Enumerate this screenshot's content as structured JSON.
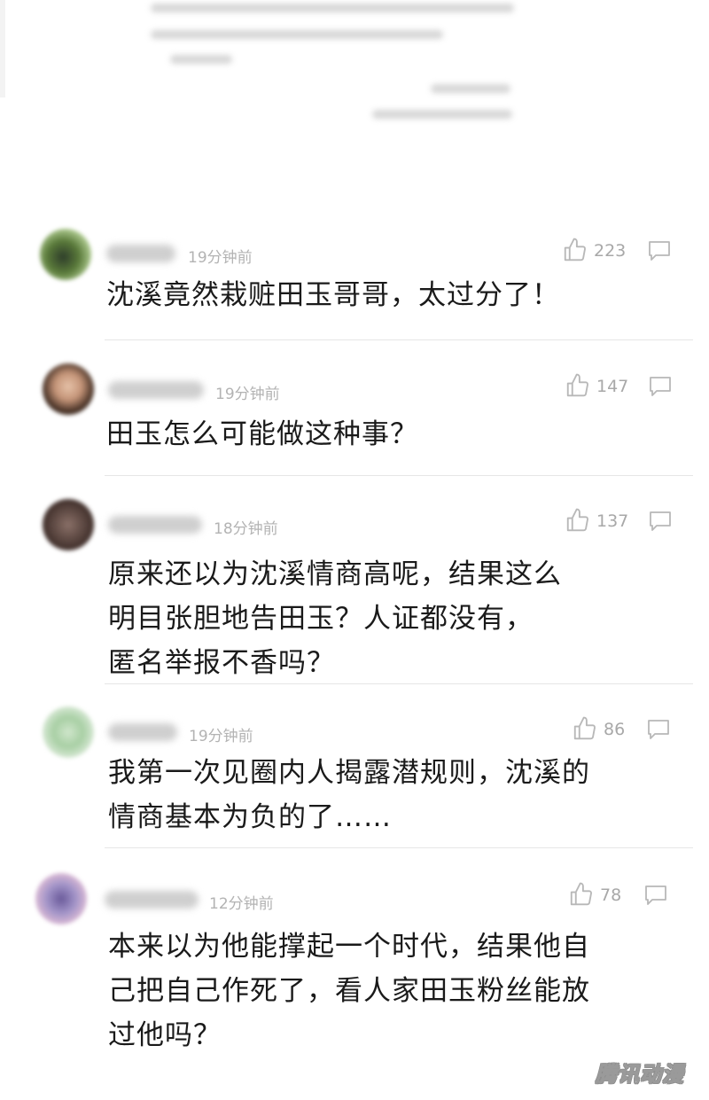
{
  "comments": [
    {
      "time": "19分钟前",
      "likes": "223",
      "text": "沈溪竟然栽赃田玉哥哥，太过分了！"
    },
    {
      "time": "19分钟前",
      "likes": "147",
      "text": "田玉怎么可能做这种事？"
    },
    {
      "time": "18分钟前",
      "likes": "137",
      "text": "原来还以为沈溪情商高呢，结果这么\n明目张胆地告田玉？人证都没有，\n匿名举报不香吗？"
    },
    {
      "time": "19分钟前",
      "likes": "86",
      "text": "我第一次见圈内人揭露潜规则，沈溪的\n情商基本为负的了……"
    },
    {
      "time": "12分钟前",
      "likes": "78",
      "text": "本来以为他能撑起一个时代，结果他自\n己把自己作死了，看人家田玉粉丝能放\n过他吗？"
    }
  ],
  "watermark": "腾讯动漫",
  "colors": {
    "text": "#1a1a1a",
    "meta": "#b3b3b3",
    "icon": "#b8b8b8",
    "divider": "#e6e6e6"
  },
  "icons": [
    "thumbs-up-icon",
    "comment-bubble-icon"
  ]
}
